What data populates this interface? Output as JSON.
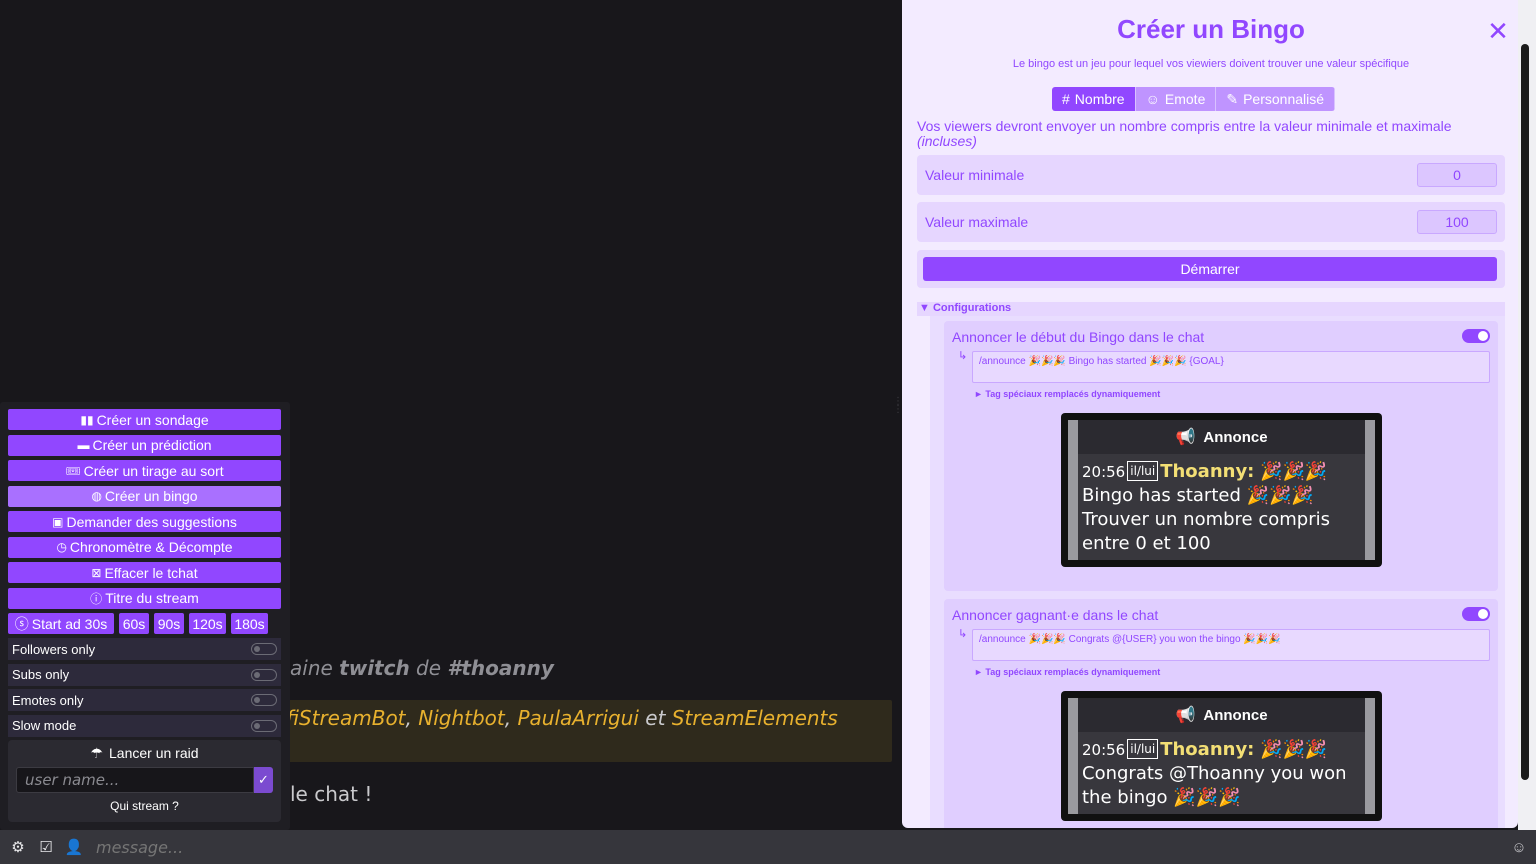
{
  "chat": {
    "msg1_pre": "aine ",
    "msg1_b1": "twitch",
    "msg1_mid": " de ",
    "msg1_b2": "#thoanny",
    "msg2_a": "fiStreamBot",
    "msg2_b": "Nightbot",
    "msg2_c": "PaulaArrigui",
    "msg2_et": " et ",
    "msg2_d": "StreamElements",
    "msg2_sep": ", ",
    "msg3": "le chat !"
  },
  "bottom": {
    "placeholder": "message..."
  },
  "tools": {
    "buttons": [
      {
        "label": "Créer un sondage",
        "icon": "poll-icon"
      },
      {
        "label": "Créer un prédiction",
        "icon": "prediction-icon"
      },
      {
        "label": "Créer un tirage au sort",
        "icon": "ticket-icon"
      },
      {
        "label": "Créer un bingo",
        "icon": "bingo-icon"
      },
      {
        "label": "Demander des suggestions",
        "icon": "suggestion-icon"
      },
      {
        "label": "Chronomètre & Décompte",
        "icon": "timer-icon"
      },
      {
        "label": "Effacer le tchat",
        "icon": "clear-chat-icon"
      },
      {
        "label": "Titre du stream",
        "icon": "info-icon"
      }
    ],
    "ads": [
      "Start ad 30s",
      "60s",
      "90s",
      "120s",
      "180s"
    ],
    "toggles": [
      "Followers only",
      "Subs only",
      "Emotes only",
      "Slow mode"
    ],
    "raid": {
      "title": "Lancer un raid",
      "placeholder": "user name...",
      "who": "Qui stream ?"
    }
  },
  "bingo": {
    "title": "Créer un Bingo",
    "subtitle": "Le bingo est un jeu pour lequel vos viewiers doivent trouver une valeur spécifique",
    "tabs": [
      "Nombre",
      "Emote",
      "Personnalisé"
    ],
    "hint": "Vos viewers devront envoyer un nombre compris entre la valeur minimale et maximale",
    "hint_italic": "(incluses)",
    "min_label": "Valeur minimale",
    "min_value": "0",
    "max_label": "Valeur maximale",
    "max_value": "100",
    "start": "Démarrer",
    "config_title": "▼ Configurations",
    "tags_link": "► Tag spéciaux remplacés dynamiquement",
    "card1": {
      "label": "Annoncer le début du Bingo dans le chat",
      "command": "/announce 🎉🎉🎉 Bingo has started 🎉🎉🎉 {GOAL}",
      "preview_head": "Annonce",
      "time": "20:56",
      "pronoun": "il/lui",
      "user": "Thoanny:",
      "msg": " 🎉🎉🎉 Bingo has started 🎉🎉🎉 Trouver un nombre compris entre 0 et 100"
    },
    "card2": {
      "label": "Annoncer gagnant·e dans le chat",
      "command": "/announce 🎉🎉🎉 Congrats @{USER} you won the bingo 🎉🎉🎉",
      "preview_head": "Annonce",
      "time": "20:56",
      "pronoun": "il/lui",
      "user": "Thoanny:",
      "msg": " 🎉🎉🎉 Congrats @Thoanny you won the bingo 🎉🎉🎉"
    }
  },
  "colors": {
    "accent": "#9147ff",
    "panel_bg": "#f3ebff",
    "dark_bg": "#18171b"
  }
}
